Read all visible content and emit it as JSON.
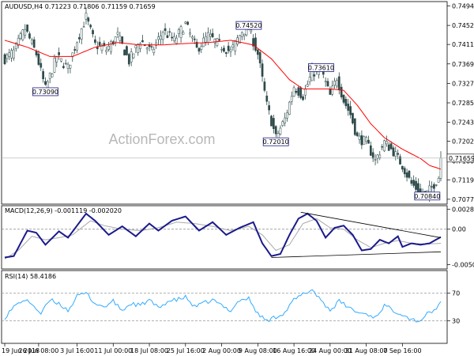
{
  "price_panel": {
    "header": "AUDUSD,H4  0.71223 0.71806 0.71159 0.71659",
    "current_price": 0.71659,
    "current_label": "0.71659",
    "ylim": [
      0.707,
      0.75
    ],
    "ticks": [
      {
        "v": 0.7494,
        "label": "0.74940"
      },
      {
        "v": 0.7452,
        "label": "0.74520"
      },
      {
        "v": 0.7411,
        "label": "0.74110"
      },
      {
        "v": 0.7369,
        "label": "0.73690"
      },
      {
        "v": 0.7327,
        "label": "0.73270"
      },
      {
        "v": 0.7285,
        "label": "0.72850"
      },
      {
        "v": 0.7243,
        "label": "0.72430"
      },
      {
        "v": 0.7202,
        "label": "0.72020"
      },
      {
        "v": 0.716,
        "label": "0.71600"
      },
      {
        "v": 0.7119,
        "label": "0.71190"
      },
      {
        "v": 0.7077,
        "label": "0.70770"
      }
    ],
    "annotations": [
      {
        "label": "0.73090",
        "v": 0.7309,
        "xi": 18
      },
      {
        "label": "0.74520",
        "v": 0.7452,
        "xi": 108
      },
      {
        "label": "0.72010",
        "v": 0.7201,
        "xi": 120
      },
      {
        "label": "0.73610",
        "v": 0.7361,
        "xi": 140
      },
      {
        "label": "0.70840",
        "v": 0.7084,
        "xi": 187
      }
    ],
    "watermark": "ActionForex.com"
  },
  "macd_panel": {
    "header": "MACD(12,26,9) -0.001119 -0.002020",
    "ylim": [
      -0.0054,
      0.0031
    ],
    "ticks": [
      {
        "v": 0.002804,
        "label": "0.002804"
      },
      {
        "v": 0.0,
        "label": "0.00"
      },
      {
        "v": -0.005019,
        "label": "-0.005019"
      }
    ]
  },
  "rsi_panel": {
    "header": "RSI(14) 58.4186",
    "ylim": [
      0,
      100
    ],
    "ticks": [
      {
        "v": 70,
        "label": "70"
      },
      {
        "v": 30,
        "label": "30"
      }
    ]
  },
  "x_axis": {
    "labels": [
      {
        "xi": 0,
        "label": "19 Jun 2018"
      },
      {
        "xi": 15,
        "label": "26 Jun 08:00"
      },
      {
        "xi": 32,
        "label": "3 Jul 16:00"
      },
      {
        "xi": 48,
        "label": "11 Jul 00:00"
      },
      {
        "xi": 64,
        "label": "18 Jul 08:00"
      },
      {
        "xi": 80,
        "label": "25 Jul 16:00"
      },
      {
        "xi": 96,
        "label": "2 Aug 00:00"
      },
      {
        "xi": 112,
        "label": "9 Aug 08:00"
      },
      {
        "xi": 128,
        "label": "16 Aug 16:00"
      },
      {
        "xi": 144,
        "label": "24 Aug 00:00"
      },
      {
        "xi": 160,
        "label": "31 Aug 08:00"
      },
      {
        "xi": 176,
        "label": "7 Sep 16:00"
      }
    ]
  },
  "chart_data": {
    "type": "candlestick",
    "symbol": "AUDUSD",
    "timeframe": "H4",
    "n_bars": 194,
    "last_ohlc": {
      "open": 0.71223,
      "high": 0.71806,
      "low": 0.71159,
      "close": 0.71659
    },
    "close_keypoints": [
      [
        0,
        0.738
      ],
      [
        4,
        0.7395
      ],
      [
        9,
        0.7445
      ],
      [
        14,
        0.739
      ],
      [
        18,
        0.7315
      ],
      [
        23,
        0.7385
      ],
      [
        28,
        0.736
      ],
      [
        32,
        0.742
      ],
      [
        36,
        0.747
      ],
      [
        40,
        0.741
      ],
      [
        45,
        0.74
      ],
      [
        50,
        0.743
      ],
      [
        55,
        0.7375
      ],
      [
        60,
        0.742
      ],
      [
        65,
        0.7395
      ],
      [
        70,
        0.744
      ],
      [
        75,
        0.742
      ],
      [
        80,
        0.7455
      ],
      [
        85,
        0.74
      ],
      [
        90,
        0.743
      ],
      [
        95,
        0.741
      ],
      [
        100,
        0.7395
      ],
      [
        105,
        0.744
      ],
      [
        108,
        0.7445
      ],
      [
        112,
        0.739
      ],
      [
        116,
        0.728
      ],
      [
        120,
        0.721
      ],
      [
        124,
        0.725
      ],
      [
        128,
        0.732
      ],
      [
        132,
        0.73
      ],
      [
        136,
        0.735
      ],
      [
        140,
        0.7355
      ],
      [
        144,
        0.73
      ],
      [
        147,
        0.734
      ],
      [
        150,
        0.729
      ],
      [
        153,
        0.726
      ],
      [
        156,
        0.721
      ],
      [
        160,
        0.72
      ],
      [
        164,
        0.716
      ],
      [
        168,
        0.72
      ],
      [
        172,
        0.718
      ],
      [
        176,
        0.715
      ],
      [
        180,
        0.711
      ],
      [
        184,
        0.7092
      ],
      [
        187,
        0.709
      ],
      [
        190,
        0.711
      ],
      [
        192,
        0.7125
      ],
      [
        193,
        0.7166
      ]
    ],
    "moving_average_keypoints": [
      [
        0,
        0.742
      ],
      [
        10,
        0.7405
      ],
      [
        20,
        0.7385
      ],
      [
        30,
        0.7385
      ],
      [
        40,
        0.7405
      ],
      [
        50,
        0.7415
      ],
      [
        60,
        0.741
      ],
      [
        70,
        0.741
      ],
      [
        80,
        0.7413
      ],
      [
        90,
        0.7415
      ],
      [
        100,
        0.742
      ],
      [
        110,
        0.741
      ],
      [
        118,
        0.738
      ],
      [
        126,
        0.7335
      ],
      [
        132,
        0.7315
      ],
      [
        138,
        0.7315
      ],
      [
        144,
        0.7315
      ],
      [
        150,
        0.7312
      ],
      [
        156,
        0.728
      ],
      [
        162,
        0.724
      ],
      [
        168,
        0.721
      ],
      [
        176,
        0.7185
      ],
      [
        184,
        0.7165
      ],
      [
        188,
        0.715
      ],
      [
        193,
        0.7142
      ]
    ],
    "macd_keypoints": [
      [
        0,
        -0.004
      ],
      [
        4,
        -0.0038
      ],
      [
        10,
        -0.0002
      ],
      [
        14,
        -0.0005
      ],
      [
        18,
        -0.0022
      ],
      [
        24,
        -0.0003
      ],
      [
        28,
        -0.0012
      ],
      [
        36,
        0.0022
      ],
      [
        40,
        0.0012
      ],
      [
        46,
        -0.0008
      ],
      [
        52,
        0.0004
      ],
      [
        58,
        -0.001
      ],
      [
        64,
        0.0008
      ],
      [
        68,
        -0.0002
      ],
      [
        74,
        0.0012
      ],
      [
        80,
        0.0018
      ],
      [
        86,
        -0.0002
      ],
      [
        92,
        0.001
      ],
      [
        98,
        -0.0008
      ],
      [
        104,
        0.0002
      ],
      [
        110,
        0.001
      ],
      [
        114,
        -0.002
      ],
      [
        118,
        -0.0038
      ],
      [
        122,
        -0.0035
      ],
      [
        126,
        -0.0008
      ],
      [
        130,
        0.0015
      ],
      [
        134,
        0.0022
      ],
      [
        138,
        0.0012
      ],
      [
        142,
        -0.0012
      ],
      [
        146,
        0.0002
      ],
      [
        150,
        0.0005
      ],
      [
        154,
        -0.0008
      ],
      [
        158,
        -0.003
      ],
      [
        162,
        -0.0028
      ],
      [
        166,
        -0.0015
      ],
      [
        170,
        -0.002
      ],
      [
        174,
        -0.001
      ],
      [
        176,
        -0.0025
      ],
      [
        180,
        -0.002
      ],
      [
        184,
        -0.0022
      ],
      [
        188,
        -0.002
      ],
      [
        193,
        -0.0011
      ]
    ],
    "signal_keypoints": [
      [
        0,
        -0.0042
      ],
      [
        6,
        -0.003
      ],
      [
        12,
        -0.001
      ],
      [
        18,
        -0.0015
      ],
      [
        24,
        -0.0012
      ],
      [
        30,
        -0.0008
      ],
      [
        38,
        0.0012
      ],
      [
        44,
        0.0005
      ],
      [
        52,
        0.0
      ],
      [
        60,
        -0.0002
      ],
      [
        68,
        0.0002
      ],
      [
        76,
        0.001
      ],
      [
        84,
        0.0008
      ],
      [
        92,
        0.0004
      ],
      [
        100,
        -0.0002
      ],
      [
        108,
        0.0004
      ],
      [
        114,
        -0.0008
      ],
      [
        120,
        -0.003
      ],
      [
        126,
        -0.0022
      ],
      [
        132,
        0.0008
      ],
      [
        138,
        0.0015
      ],
      [
        144,
        0.0002
      ],
      [
        150,
        0.0
      ],
      [
        156,
        -0.0015
      ],
      [
        162,
        -0.0026
      ],
      [
        168,
        -0.002
      ],
      [
        174,
        -0.0016
      ],
      [
        180,
        -0.002
      ],
      [
        186,
        -0.0021
      ],
      [
        193,
        -0.002
      ]
    ],
    "macd_trendlines": [
      {
        "from": [
          131,
          0.0024
        ],
        "to": [
          193,
          -0.0012
        ]
      },
      {
        "from": [
          118,
          -0.004
        ],
        "to": [
          193,
          -0.0032
        ]
      }
    ],
    "rsi_keypoints": [
      [
        0,
        35
      ],
      [
        4,
        50
      ],
      [
        8,
        60
      ],
      [
        12,
        55
      ],
      [
        16,
        40
      ],
      [
        20,
        60
      ],
      [
        24,
        55
      ],
      [
        28,
        45
      ],
      [
        32,
        65
      ],
      [
        36,
        70
      ],
      [
        40,
        55
      ],
      [
        44,
        50
      ],
      [
        48,
        58
      ],
      [
        52,
        45
      ],
      [
        56,
        55
      ],
      [
        60,
        52
      ],
      [
        64,
        60
      ],
      [
        68,
        48
      ],
      [
        72,
        58
      ],
      [
        76,
        60
      ],
      [
        80,
        64
      ],
      [
        84,
        50
      ],
      [
        88,
        55
      ],
      [
        92,
        60
      ],
      [
        96,
        52
      ],
      [
        100,
        45
      ],
      [
        104,
        60
      ],
      [
        108,
        62
      ],
      [
        112,
        40
      ],
      [
        116,
        30
      ],
      [
        120,
        36
      ],
      [
        124,
        42
      ],
      [
        128,
        60
      ],
      [
        132,
        68
      ],
      [
        136,
        75
      ],
      [
        140,
        60
      ],
      [
        144,
        45
      ],
      [
        148,
        58
      ],
      [
        152,
        50
      ],
      [
        156,
        42
      ],
      [
        160,
        40
      ],
      [
        164,
        35
      ],
      [
        168,
        52
      ],
      [
        172,
        45
      ],
      [
        176,
        40
      ],
      [
        180,
        32
      ],
      [
        184,
        30
      ],
      [
        186,
        38
      ],
      [
        190,
        45
      ],
      [
        193,
        58
      ]
    ]
  }
}
